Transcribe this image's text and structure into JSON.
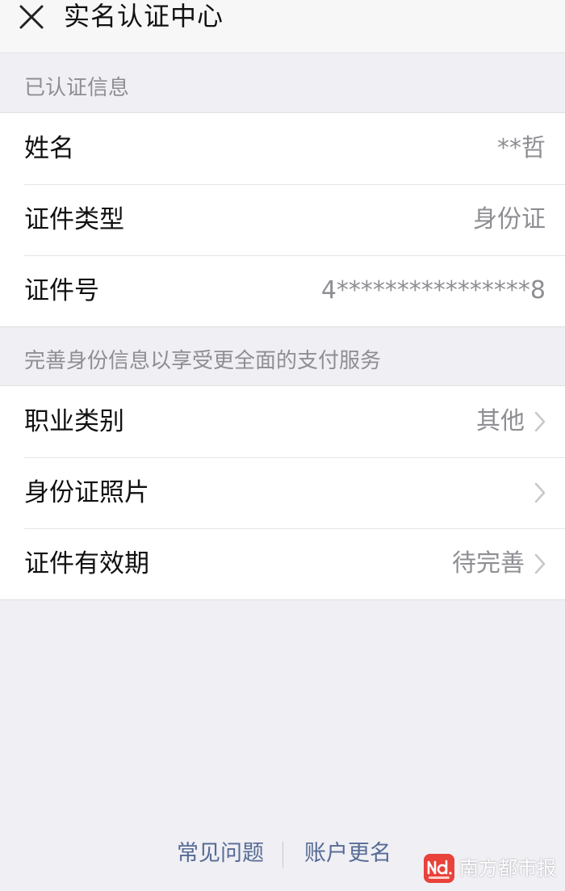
{
  "colors": {
    "page_bg": "#efeff4",
    "nav_bg": "#f7f7f7",
    "label_text": "#111111",
    "value_text": "#8e8e93",
    "link_blue": "#576b95",
    "brand_red": "#e8423a"
  },
  "nav": {
    "close_icon": "close-icon",
    "title": "实名认证中心"
  },
  "verified_section": {
    "header": "已认证信息",
    "rows": [
      {
        "label": "姓名",
        "value": "**哲"
      },
      {
        "label": "证件类型",
        "value": "身份证"
      },
      {
        "label": "证件号",
        "value": "4****************8"
      }
    ]
  },
  "complete_section": {
    "header": "完善身份信息以享受更全面的支付服务",
    "rows": [
      {
        "label": "职业类别",
        "value": "其他",
        "icon": "chevron-right-icon"
      },
      {
        "label": "身份证照片",
        "value": "",
        "icon": "chevron-right-icon"
      },
      {
        "label": "证件有效期",
        "value": "待完善",
        "icon": "chevron-right-icon"
      }
    ]
  },
  "footer": {
    "faq_link": "常见问题",
    "rename_link": "账户更名"
  },
  "watermark": {
    "text": "南方都市报",
    "logo_text": "Nd"
  }
}
